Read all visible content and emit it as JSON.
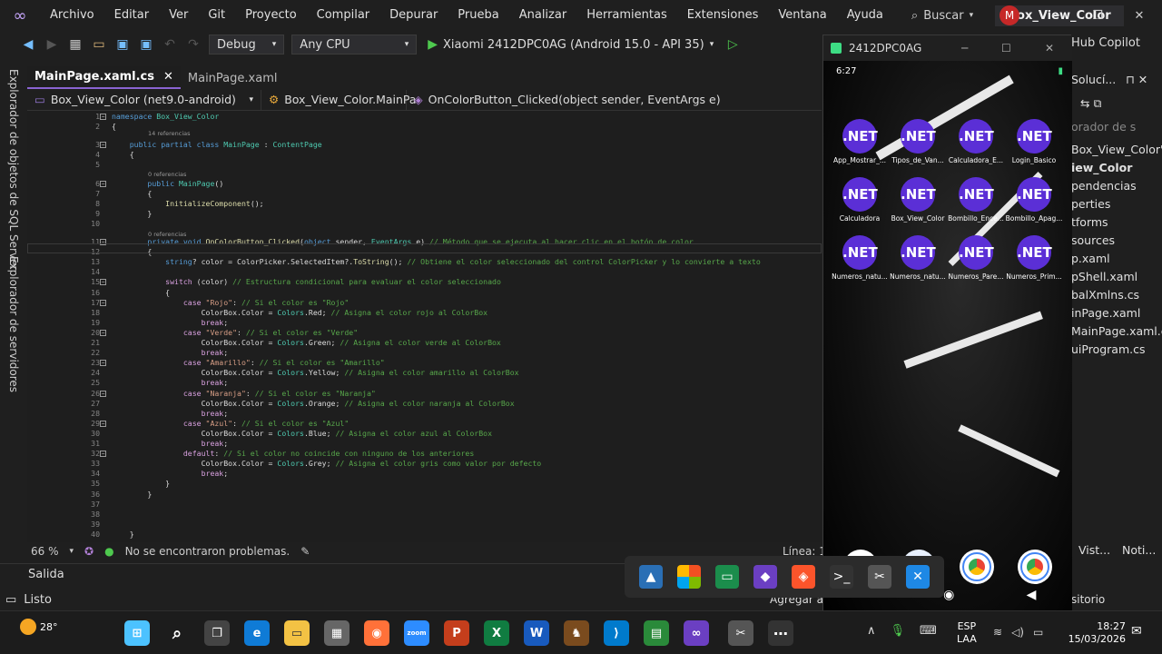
{
  "menu": {
    "items": [
      "Archivo",
      "Editar",
      "Ver",
      "Git",
      "Proyecto",
      "Compilar",
      "Depurar",
      "Prueba",
      "Analizar",
      "Herramientas",
      "Extensiones",
      "Ventana",
      "Ayuda"
    ],
    "search_label": "Buscar",
    "solution_name": "Box_View_Color",
    "avatar_initial": "M"
  },
  "toolbar": {
    "config": "Debug",
    "platform": "Any CPU",
    "run_target": "Xiaomi 2412DPC0AG (Android 15.0 - API 35)",
    "copilot": "Hub Copilot"
  },
  "side_tabs": {
    "sql": "Explorador de objetos de SQL Server",
    "servers": "Explorador de servidores"
  },
  "tabs": [
    {
      "label": "MainPage.xaml.cs",
      "active": true
    },
    {
      "label": "MainPage.xaml",
      "active": false
    }
  ],
  "nav": {
    "project": "Box_View_Color (net9.0-android)",
    "class": "Box_View_Color.MainPa",
    "member": "OnColorButton_Clicked(object sender, EventArgs e)"
  },
  "editor": {
    "refs14": "14 referencias",
    "refs0": "0 referencias",
    "lines": [
      {
        "n": "1",
        "parts": [
          [
            "kw",
            "namespace "
          ],
          [
            "ty",
            "Box_View_Color"
          ]
        ]
      },
      {
        "n": "2",
        "parts": [
          [
            "pn",
            "{"
          ]
        ]
      },
      {
        "n": "3",
        "parts": [
          [
            "kw",
            "    public partial class "
          ],
          [
            "ty",
            "MainPage"
          ],
          [
            "pn",
            " : "
          ],
          [
            "ty",
            "ContentPage"
          ]
        ]
      },
      {
        "n": "4",
        "parts": [
          [
            "pn",
            "    {"
          ]
        ]
      },
      {
        "n": "5",
        "parts": [
          [
            "pn",
            ""
          ]
        ]
      },
      {
        "n": "6",
        "parts": [
          [
            "kw",
            "        public "
          ],
          [
            "ty",
            "MainPage"
          ],
          [
            "pn",
            "()"
          ]
        ]
      },
      {
        "n": "7",
        "parts": [
          [
            "pn",
            "        {"
          ]
        ]
      },
      {
        "n": "8",
        "parts": [
          [
            "fn",
            "            InitializeComponent"
          ],
          [
            "pn",
            "();"
          ]
        ]
      },
      {
        "n": "9",
        "parts": [
          [
            "pn",
            "        }"
          ]
        ]
      },
      {
        "n": "10",
        "parts": [
          [
            "pn",
            ""
          ]
        ]
      },
      {
        "n": "11",
        "parts": [
          [
            "kw",
            "        private void "
          ],
          [
            "fn",
            "OnColorButton_Clicked"
          ],
          [
            "pn",
            "("
          ],
          [
            "kw",
            "object "
          ],
          [
            "pn",
            "sender, "
          ],
          [
            "ty",
            "EventArgs "
          ],
          [
            "pn",
            "e) "
          ],
          [
            "cm",
            "// Método que se ejecuta al hacer clic en el botón de color"
          ]
        ]
      },
      {
        "n": "12",
        "parts": [
          [
            "pn",
            "        {"
          ]
        ]
      },
      {
        "n": "13",
        "parts": [
          [
            "kw",
            "            string"
          ],
          [
            "pn",
            "? color = ColorPicker.SelectedItem?."
          ],
          [
            "fn",
            "ToString"
          ],
          [
            "pn",
            "(); "
          ],
          [
            "cm",
            "// Obtiene el color seleccionado del control ColorPicker y lo convierte a texto"
          ]
        ]
      },
      {
        "n": "14",
        "parts": [
          [
            "pn",
            ""
          ]
        ]
      },
      {
        "n": "15",
        "parts": [
          [
            "ctl",
            "            switch "
          ],
          [
            "pn",
            "(color) "
          ],
          [
            "cm",
            "// Estructura condicional para evaluar el color seleccionado"
          ]
        ]
      },
      {
        "n": "16",
        "parts": [
          [
            "pn",
            "            {"
          ]
        ]
      },
      {
        "n": "17",
        "parts": [
          [
            "ctl",
            "                case "
          ],
          [
            "str",
            "\"Rojo\""
          ],
          [
            "pn",
            ": "
          ],
          [
            "cm",
            "// Si el color es \"Rojo\""
          ]
        ]
      },
      {
        "n": "18",
        "parts": [
          [
            "pn",
            "                    ColorBox.Color = "
          ],
          [
            "ty",
            "Colors"
          ],
          [
            "pn",
            ".Red; "
          ],
          [
            "cm",
            "// Asigna el color rojo al ColorBox"
          ]
        ]
      },
      {
        "n": "19",
        "parts": [
          [
            "ctl",
            "                    break"
          ],
          [
            "pn",
            ";"
          ]
        ]
      },
      {
        "n": "20",
        "parts": [
          [
            "ctl",
            "                case "
          ],
          [
            "str",
            "\"Verde\""
          ],
          [
            "pn",
            ": "
          ],
          [
            "cm",
            "// Si el color es \"Verde\""
          ]
        ]
      },
      {
        "n": "21",
        "parts": [
          [
            "pn",
            "                    ColorBox.Color = "
          ],
          [
            "ty",
            "Colors"
          ],
          [
            "pn",
            ".Green; "
          ],
          [
            "cm",
            "// Asigna el color verde al ColorBox"
          ]
        ]
      },
      {
        "n": "22",
        "parts": [
          [
            "ctl",
            "                    break"
          ],
          [
            "pn",
            ";"
          ]
        ]
      },
      {
        "n": "23",
        "parts": [
          [
            "ctl",
            "                case "
          ],
          [
            "str",
            "\"Amarillo\""
          ],
          [
            "pn",
            ": "
          ],
          [
            "cm",
            "// Si el color es \"Amarillo\""
          ]
        ]
      },
      {
        "n": "24",
        "parts": [
          [
            "pn",
            "                    ColorBox.Color = "
          ],
          [
            "ty",
            "Colors"
          ],
          [
            "pn",
            ".Yellow; "
          ],
          [
            "cm",
            "// Asigna el color amarillo al ColorBox"
          ]
        ]
      },
      {
        "n": "25",
        "parts": [
          [
            "ctl",
            "                    break"
          ],
          [
            "pn",
            ";"
          ]
        ]
      },
      {
        "n": "26",
        "parts": [
          [
            "ctl",
            "                case "
          ],
          [
            "str",
            "\"Naranja\""
          ],
          [
            "pn",
            ": "
          ],
          [
            "cm",
            "// Si el color es \"Naranja\""
          ]
        ]
      },
      {
        "n": "27",
        "parts": [
          [
            "pn",
            "                    ColorBox.Color = "
          ],
          [
            "ty",
            "Colors"
          ],
          [
            "pn",
            ".Orange; "
          ],
          [
            "cm",
            "// Asigna el color naranja al ColorBox"
          ]
        ]
      },
      {
        "n": "28",
        "parts": [
          [
            "ctl",
            "                    break"
          ],
          [
            "pn",
            ";"
          ]
        ]
      },
      {
        "n": "29",
        "parts": [
          [
            "ctl",
            "                case "
          ],
          [
            "str",
            "\"Azul\""
          ],
          [
            "pn",
            ": "
          ],
          [
            "cm",
            "// Si el color es \"Azul\""
          ]
        ]
      },
      {
        "n": "30",
        "parts": [
          [
            "pn",
            "                    ColorBox.Color = "
          ],
          [
            "ty",
            "Colors"
          ],
          [
            "pn",
            ".Blue; "
          ],
          [
            "cm",
            "// Asigna el color azul al ColorBox"
          ]
        ]
      },
      {
        "n": "31",
        "parts": [
          [
            "ctl",
            "                    break"
          ],
          [
            "pn",
            ";"
          ]
        ]
      },
      {
        "n": "32",
        "parts": [
          [
            "ctl",
            "                default"
          ],
          [
            "pn",
            ": "
          ],
          [
            "cm",
            "// Si el color no coincide con ninguno de los anteriores"
          ]
        ]
      },
      {
        "n": "33",
        "parts": [
          [
            "pn",
            "                    ColorBox.Color = "
          ],
          [
            "ty",
            "Colors"
          ],
          [
            "pn",
            ".Grey; "
          ],
          [
            "cm",
            "// Asigna el color gris como valor por defecto"
          ]
        ]
      },
      {
        "n": "34",
        "parts": [
          [
            "ctl",
            "                    break"
          ],
          [
            "pn",
            ";"
          ]
        ]
      },
      {
        "n": "35",
        "parts": [
          [
            "pn",
            "            }"
          ]
        ]
      },
      {
        "n": "36",
        "parts": [
          [
            "pn",
            "        }"
          ]
        ]
      },
      {
        "n": "37",
        "parts": [
          [
            "pn",
            ""
          ]
        ]
      },
      {
        "n": "38",
        "parts": [
          [
            "pn",
            ""
          ]
        ]
      },
      {
        "n": "39",
        "parts": [
          [
            "pn",
            ""
          ]
        ]
      },
      {
        "n": "40",
        "parts": [
          [
            "pn",
            "    }"
          ]
        ]
      }
    ]
  },
  "status": {
    "zoom": "66 %",
    "problems": "No se encontraron problemas.",
    "line": "Línea: 11",
    "output": "Salida",
    "ready": "Listo",
    "add": "Agregar al",
    "repo": "sitorio"
  },
  "right_panel": {
    "header": "Solucí...",
    "search": "orador de s",
    "items": [
      "Box_View_Color\"",
      "iew_Color",
      "pendencias",
      "perties",
      "tforms",
      "sources",
      "p.xaml",
      "pShell.xaml",
      "balXmlns.cs",
      "inPage.xaml",
      "MainPage.xaml.cs",
      "uiProgram.cs"
    ],
    "tabs": [
      "Vist...",
      "Noti..."
    ]
  },
  "emulator": {
    "title": "2412DPC0AG",
    "time": "6:27",
    "apps": [
      {
        "icon": ".NET",
        "label": "App_Mostrar_..."
      },
      {
        "icon": ".NET",
        "label": "Tipos_de_Van..."
      },
      {
        "icon": ".NET",
        "label": "Calculadora_E..."
      },
      {
        "icon": ".NET",
        "label": "Login_Basico"
      },
      {
        "icon": ".NET",
        "label": "Calculadora"
      },
      {
        "icon": ".NET",
        "label": "Box_View_Color"
      },
      {
        "icon": ".NET",
        "label": "Bombillo_Ence..."
      },
      {
        "icon": ".NET",
        "label": "Bombillo_Apag..."
      },
      {
        "icon": ".NET",
        "label": "Numeros_natu..."
      },
      {
        "icon": ".NET",
        "label": "Numeros_natu..."
      },
      {
        "icon": ".NET",
        "label": "Numeros_Pare..."
      },
      {
        "icon": ".NET",
        "label": "Numeros_Prim..."
      }
    ]
  },
  "taskbar": {
    "temp": "28°",
    "lang1": "ESP",
    "lang2": "LAA",
    "time": "18:27",
    "date": "15/03/2026"
  },
  "colors": {
    "accent": "#8a63d2",
    "dotnet": "#5b2fd6",
    "ok": "#4ec94e"
  }
}
